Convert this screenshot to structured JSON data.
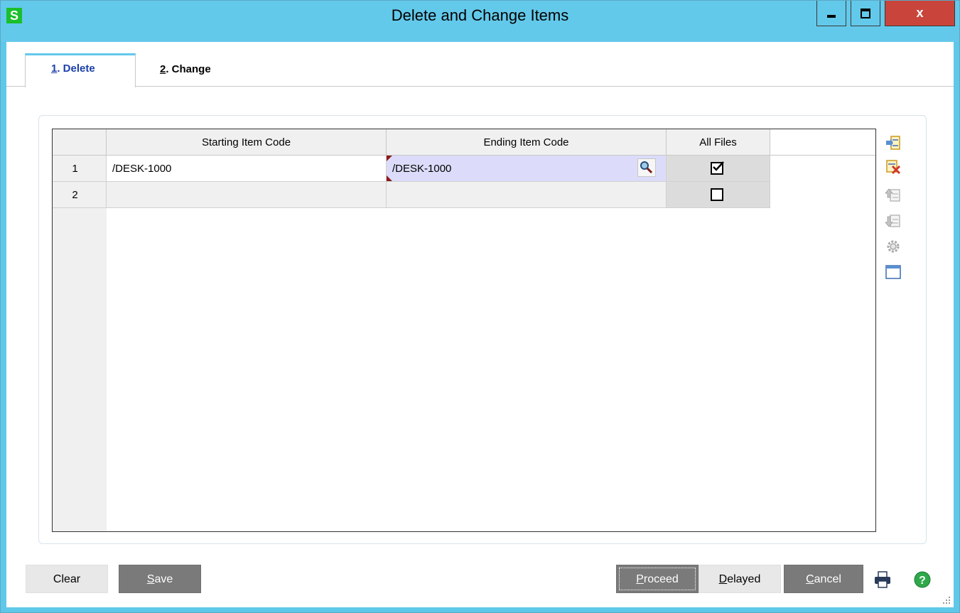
{
  "window": {
    "title": "Delete and Change Items",
    "app_icon_letter": "S",
    "close_glyph": "x"
  },
  "tabs": [
    {
      "number": "1",
      "label": ". Delete",
      "active": true
    },
    {
      "number": "2",
      "label": ". Change",
      "active": false
    }
  ],
  "grid": {
    "columns": [
      "Starting Item Code",
      "Ending Item Code",
      "All Files"
    ],
    "rows": [
      {
        "num": "1",
        "starting": "/DESK-1000",
        "ending": "/DESK-1000",
        "all_files": true
      },
      {
        "num": "2",
        "starting": "",
        "ending": "",
        "all_files": false
      }
    ]
  },
  "side_tools": [
    "insert-row-icon",
    "delete-row-icon",
    "move-up-icon",
    "move-down-icon",
    "settings-gear-icon",
    "window-icon"
  ],
  "footer": {
    "clear": {
      "mnemonic": "",
      "rest": "Clear",
      "pre": "C",
      "post": "lear"
    },
    "save": {
      "pre": "",
      "mn": "S",
      "post": "ave"
    },
    "proceed": {
      "pre": "",
      "mn": "P",
      "post": "roceed"
    },
    "delayed": {
      "pre": "",
      "mn": "D",
      "post": "elayed"
    },
    "cancel": {
      "pre": "",
      "mn": "C",
      "post": "ancel"
    }
  },
  "colors": {
    "titlebar": "#63c9ea",
    "close_button": "#c9453b",
    "active_tab_text": "#1a3fa8",
    "active_cell": "#dcdcfa",
    "dark_button": "#7a7a7a"
  }
}
